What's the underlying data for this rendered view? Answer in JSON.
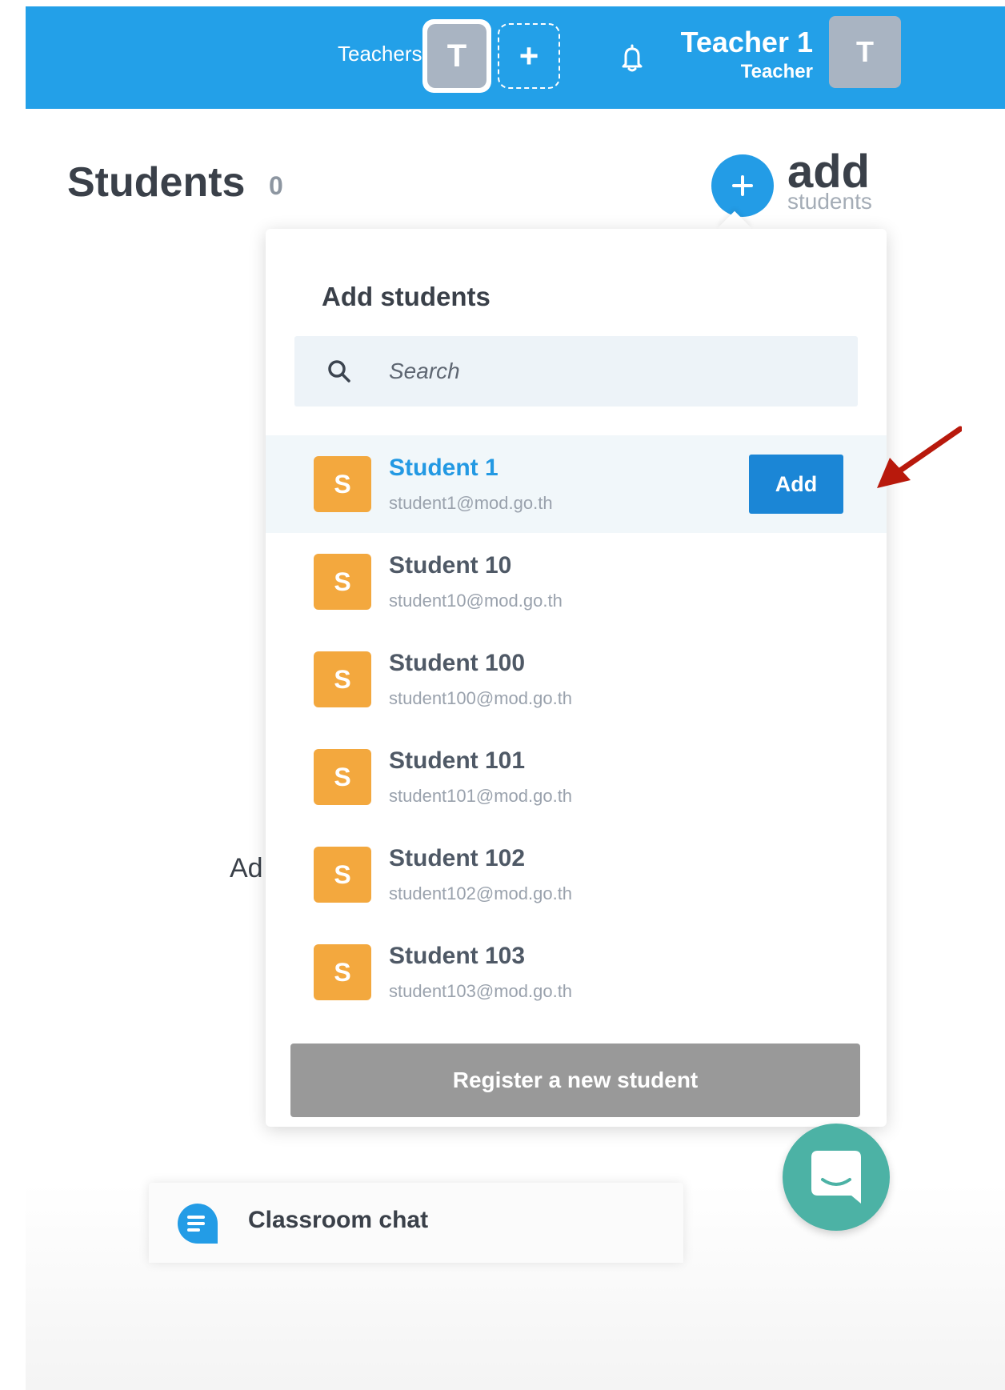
{
  "header": {
    "teachers_label": "Teachers",
    "teacher_avatar_letter": "T",
    "add_teacher_glyph": "+",
    "bell_icon": "bell-icon",
    "user_name": "Teacher 1",
    "user_role": "Teacher",
    "user_avatar_letter": "T",
    "bar_color": "#23a0e8"
  },
  "page": {
    "title": "Students",
    "count": "0",
    "add_button_glyph": "+",
    "add_label": "add",
    "add_sublabel": "students",
    "partially_hidden_text": "Ad"
  },
  "popover": {
    "title": "Add students",
    "search_placeholder": "Search",
    "search_icon": "search-icon",
    "students": [
      {
        "initial": "S",
        "name": "Student 1",
        "email": "student1@mod.go.th",
        "hovered": true,
        "action": "Add"
      },
      {
        "initial": "S",
        "name": "Student 10",
        "email": "student10@mod.go.th"
      },
      {
        "initial": "S",
        "name": "Student 100",
        "email": "student100@mod.go.th"
      },
      {
        "initial": "S",
        "name": "Student 101",
        "email": "student101@mod.go.th"
      },
      {
        "initial": "S",
        "name": "Student 102",
        "email": "student102@mod.go.th"
      },
      {
        "initial": "S",
        "name": "Student 103",
        "email": "student103@mod.go.th"
      }
    ],
    "register_label": "Register a new student",
    "avatar_color": "#f3a83e",
    "highlight_color": "#2399e3"
  },
  "footer": {
    "chat_label": "Classroom chat",
    "chat_icon": "chat-bubble-icon",
    "launcher_icon": "messenger-launcher-icon",
    "launcher_color": "#4cb2a5"
  },
  "annotation": {
    "arrow_icon": "red-arrow-icon",
    "color": "#b8190c"
  }
}
